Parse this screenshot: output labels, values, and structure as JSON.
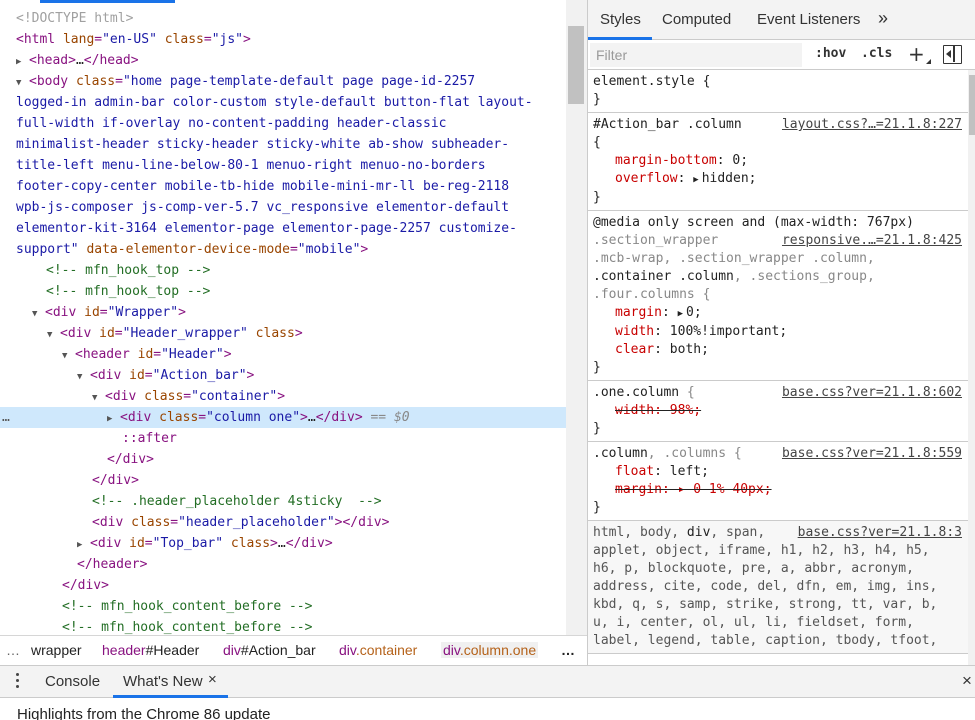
{
  "dom_tree": {
    "line1": "<!DOCTYPE html>",
    "html_tag_open": "<html",
    "html_lang_attr": " lang",
    "html_lang_val": "\"en-US\"",
    "html_class_attr": " class",
    "html_class_val": "\"js\"",
    "tag_close": ">",
    "head_tag": "<head>",
    "head_ellipsis": "…",
    "head_close": "</head>",
    "body_tag_open": "<body",
    "body_class_attr": " class",
    "body_class_val_lines": [
      "\"home page-template-default page page-id-2257",
      "logged-in admin-bar color-custom style-default button-flat layout-",
      "full-width if-overlay no-content-padding header-classic",
      "minimalist-header sticky-header sticky-white ab-show subheader-",
      "title-left menu-line-below-80-1 menuo-right menuo-no-borders",
      "footer-copy-center mobile-tb-hide mobile-mini-mr-ll be-reg-2118",
      "wpb-js-composer js-comp-ver-5.7 vc_responsive elementor-default",
      "elementor-kit-3164 elementor-page elementor-page-2257 customize-",
      "support\""
    ],
    "body_data_attr": " data-elementor-device-mode",
    "body_data_val": "\"mobile\"",
    "comment_hook_top": "<!-- mfn_hook_top -->",
    "div_open": "<div",
    "div_close": "</div>",
    "id_attr": " id",
    "class_attr": " class",
    "wrapper_val": "\"Wrapper\"",
    "header_wrapper_val": "\"Header_wrapper\"",
    "header_open": "<header",
    "header_val": "\"Header\"",
    "action_bar_val": "\"Action_bar\"",
    "container_val": "\"container\"",
    "column_one_val": "\"column one\"",
    "selected_ellipsis": "…",
    "selected_eq": " == $0",
    "selected_dots": "…",
    "after_pseudo": "::after",
    "comment_placeholder": "<!-- .header_placeholder 4sticky  -->",
    "header_placeholder_val": "\"header_placeholder\"",
    "top_bar_val": "\"Top_bar\"",
    "header_close": "</header>",
    "comment_content_before": "<!-- mfn_hook_content_before -->"
  },
  "breadcrumbs": {
    "ellipsis": "…",
    "wrapper": "wrapper",
    "header_tag": "header",
    "header_id": "#Header",
    "action_tag": "div",
    "action_id": "#Action_bar",
    "container_tag": "div",
    "container_cls": ".container",
    "column_tag": "div",
    "column_cls": ".column.one",
    "more": "…"
  },
  "styles": {
    "tabs": {
      "styles": "Styles",
      "computed": "Computed",
      "event_listeners": "Event Listeners",
      "more": "»"
    },
    "filter_placeholder": "Filter",
    "hov": ":hov",
    "cls": ".cls",
    "plus": "+",
    "rules": {
      "element_style": "element.style {",
      "close_brace": "}",
      "r1_selector": "#Action_bar .column",
      "r1_source": "layout.css?…=21.1.8:227",
      "open_brace": "{",
      "r1_p1_name": "margin-bottom",
      "r1_p1_val": "0;",
      "r1_p2_name": "overflow",
      "r1_p2_val": "hidden;",
      "r2_media": "@media only screen and (max-width: 767px)",
      "r2_sel_1": ".section_wrapper",
      "r2_source": "responsive.…=21.1.8:425",
      "r2_sel_2": ".mcb-wrap, .section_wrapper .column,",
      "r2_sel_3_match": ".container .column",
      "r2_sel_3_rest": ", .sections_group,",
      "r2_sel_4": ".four.columns {",
      "r2_p1_name": "margin",
      "r2_p1_val": "0;",
      "r2_p2_name": "width",
      "r2_p2_val": "100%!important;",
      "r2_p3_name": "clear",
      "r2_p3_val": "both;",
      "r3_selector": ".one.column",
      "r3_brace": " {",
      "r3_source": "base.css?ver=21.1.8:602",
      "r3_p1": "width: 98%;",
      "r4_sel_match": ".column",
      "r4_sel_rest": ", .columns",
      "r4_brace": " {",
      "r4_source": "base.css?ver=21.1.8:559",
      "r4_p1_name": "float",
      "r4_p1_val": "left;",
      "r4_p2": "margin: ▸ 0 1% 40px;",
      "r5_sel_pre": "html, body, ",
      "r5_sel_match": "div",
      "r5_sel_rest": ", span,",
      "r5_source": "base.css?ver=21.1.8:3",
      "r5_lines": [
        "applet, object, iframe, h1, h2, h3, h4, h5,",
        "h6, p, blockquote, pre, a, abbr, acronym,",
        "address, cite, code, del, dfn, em, img, ins,",
        "kbd, q, s, samp, strike, strong, tt, var, b,",
        "u, i, center, ol, ul, li, fieldset, form,",
        "label, legend, table, caption, tbody, tfoot,"
      ],
      "colon": ": "
    }
  },
  "drawer": {
    "console": "Console",
    "whats_new": "What's New",
    "close": "×",
    "content": "Highlights from the Chrome 86 update"
  }
}
